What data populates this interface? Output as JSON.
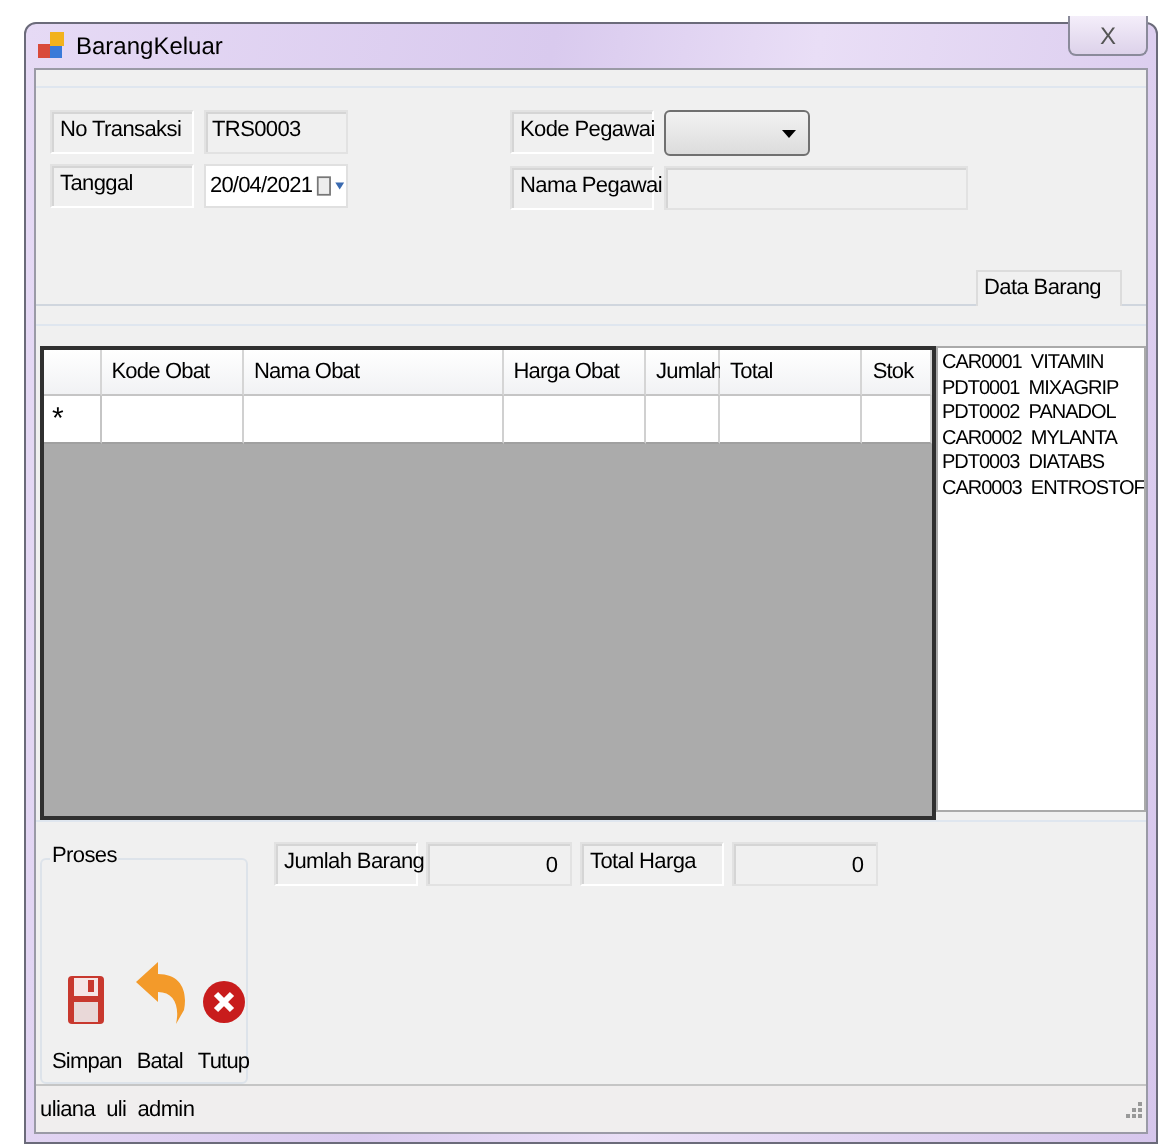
{
  "window": {
    "title": "BarangKeluar",
    "close_glyph": "X"
  },
  "header_fields": [
    {
      "label": "No Transaksi",
      "kind": "text",
      "value": "TRS0003"
    },
    {
      "label": "Tanggal",
      "kind": "date",
      "value": "20/04/2021"
    }
  ],
  "employee_fields": [
    {
      "label": "Kode Pegawai",
      "kind": "dropdown"
    },
    {
      "label": "Nama Pegawai",
      "kind": "text"
    }
  ],
  "list_title": "Data Barang",
  "table": {
    "columns": [
      "Kode Obat",
      "Nama Obat",
      "Harga Obat",
      "Jumlah",
      "Total",
      "Stok"
    ],
    "new_row_marker": "*"
  },
  "items_list": [
    "CAR0001  VITAMIN",
    "PDT0001  MIXAGRIP",
    "PDT0002  PANADOL",
    "CAR0002  MYLANTA",
    "PDT0003  DIATABS",
    "CAR0003  ENTROSTOF"
  ],
  "totals": [
    {
      "label": "Jumlah Barang",
      "value": "0"
    },
    {
      "label": "Total Harga",
      "value": "0"
    }
  ],
  "actions": {
    "title": "Proses",
    "buttons": [
      {
        "label": "Simpan",
        "kind": "save"
      },
      {
        "label": "Batal",
        "kind": "undo"
      },
      {
        "label": "Tutup",
        "kind": "close"
      }
    ]
  },
  "status_bar": [
    "uliana",
    "uli",
    "admin"
  ]
}
